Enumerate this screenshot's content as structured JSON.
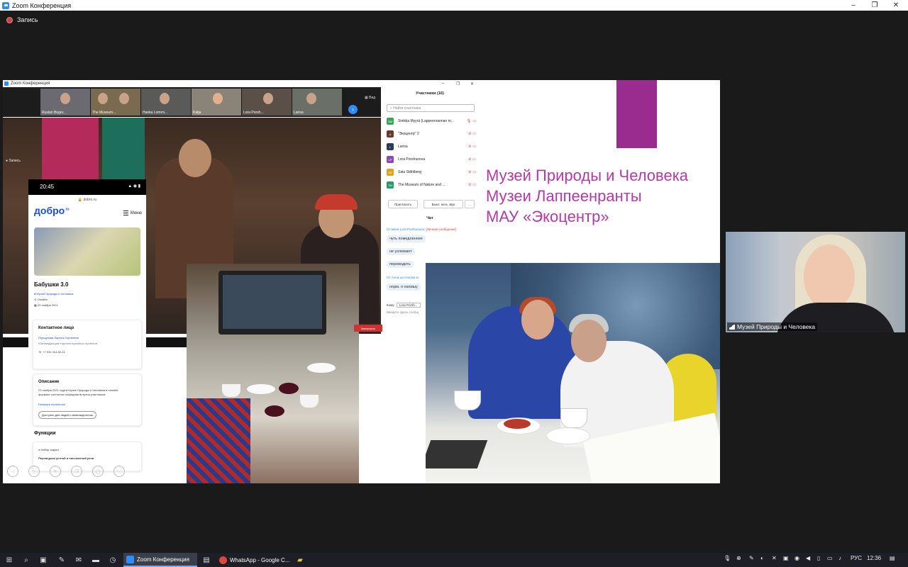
{
  "window": {
    "title": "Zoom Конференция",
    "controls": {
      "minimize": "–",
      "maximize": "❐",
      "close": "✕"
    },
    "recording_label": "Запись"
  },
  "inner_window": {
    "title": "Zoom Конференция",
    "recording_label": "Запись",
    "view_label": "Вид",
    "thumbnails": [
      "Ruslan Bogor...",
      "The Museum...",
      "Hanka Lommi...",
      "Katja",
      "Lora Porsh...",
      "Larisa"
    ]
  },
  "phone": {
    "time": "20:45",
    "status_icons": "▲ ◉ ▮",
    "url": "dobro.ru",
    "logo": "добро",
    "logo_sup": ".ru",
    "menu_label": "Меню",
    "project_title": "Бабушки 3.0",
    "organizer": "Музей Природы и Человека",
    "format": "Онлайн",
    "date": "23 ноября 2021",
    "contact": {
      "heading": "Контактное лицо",
      "name": "Порщунова Лариса Сергеевна",
      "role": "ИЗвлаедующая отделом музейных проектов",
      "phone": "+7 932 414-52-21"
    },
    "description": {
      "heading": "Описание",
      "text_line1": "23 ноября 2021 года в Музее Природы и Человека в онлайн-",
      "text_line2": "формате состоится очередная встреча участников",
      "more_link": "Показать полностью",
      "button": "Доступно для людей с инвалидностью"
    },
    "functions": {
      "heading": "Функции",
      "item1": "Набор закрыт",
      "item2": "Переводчик устной и письменной речи"
    },
    "nav_icons": [
      "◁",
      "▷",
      "✎",
      "❐",
      "◯",
      "⋯"
    ]
  },
  "participants": {
    "header": "Участники (16)",
    "search_placeholder": "Найти участника",
    "list": [
      {
        "initials": "SM",
        "name": "Sinikka Myyrä (Lappeenrannan m...",
        "color": "#3aa655"
      },
      {
        "initials": "А",
        "name": "\"Экоцентр\" 2",
        "color": "#6b3a2a"
      },
      {
        "initials": "L",
        "name": "Larisa",
        "color": "#2e3a5a"
      },
      {
        "initials": "LP",
        "name": "Lora Porshunova",
        "color": "#8a4ab0"
      },
      {
        "initials": "SS",
        "name": "Satu Ståhlberg",
        "color": "#e0a020"
      },
      {
        "initials": "TM",
        "name": "The Museum of Nature and ...",
        "color": "#2a9a6a"
      }
    ],
    "invite_button": "Пригласить",
    "mute_all_button": "Выкл. весь звук",
    "more_button": "..."
  },
  "chat": {
    "header": "Чат",
    "from1": "От меня Lora Porshunova:",
    "private1": "(Личное сообщение)",
    "messages1": [
      "чуть помедленнее",
      "не успевают",
      "переводить"
    ],
    "from2": "От Anna ыстопкова м",
    "messages2": [
      "норм. я напишу"
    ],
    "to_label": "Кому:",
    "to_value": "Lora Porsh...",
    "input_placeholder": "Введите здесь сообщ",
    "end_button": "Завершить"
  },
  "slide": {
    "line1": "Музей Природы и Человека",
    "line2": "Музеи Лаппеенранты",
    "line3": "МАУ «Экоцентр»",
    "accent_color": "#9b2c8f",
    "text_color": "#b23aa8"
  },
  "self_view": {
    "name": "Музей Природы и Человека"
  },
  "taskbar": {
    "apps": [
      {
        "label": "Zoom Конференция",
        "active": true,
        "icon_color": "#2d8cff"
      },
      {
        "label": "WhatsApp - Google C...",
        "active": false,
        "icon_color": "#e0463a"
      }
    ],
    "language": "РУС",
    "time": "12:36"
  }
}
